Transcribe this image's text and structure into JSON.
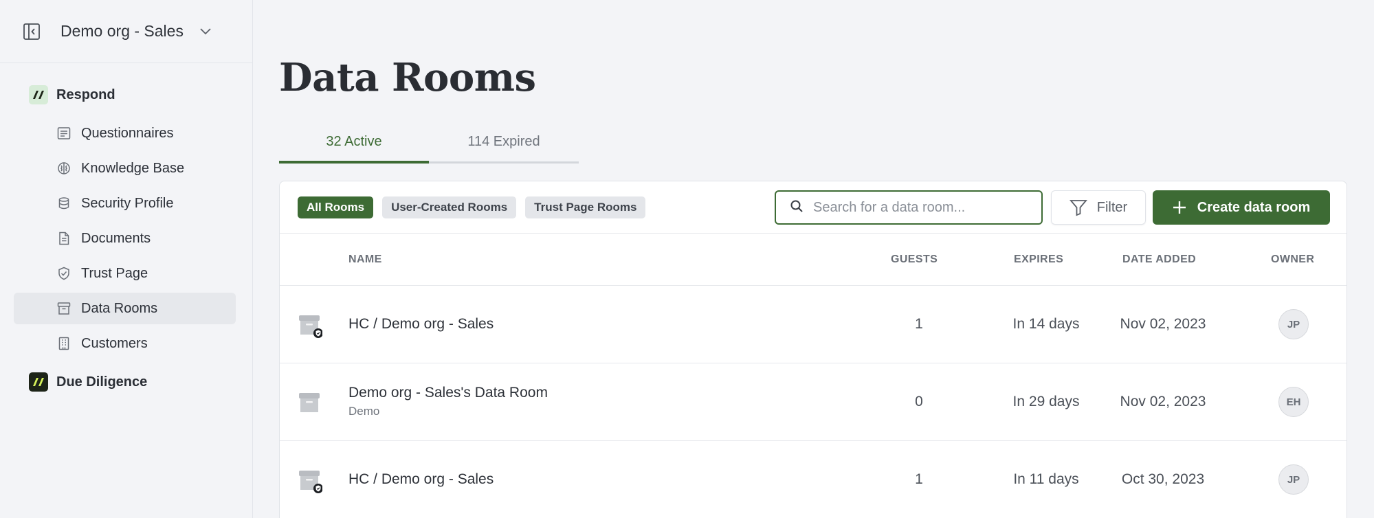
{
  "org": {
    "name": "Demo org - Sales"
  },
  "sidebar": {
    "groups": [
      {
        "label": "Respond",
        "items": [
          {
            "label": "Questionnaires",
            "icon": "questionnaire-icon"
          },
          {
            "label": "Knowledge Base",
            "icon": "brain-icon"
          },
          {
            "label": "Security Profile",
            "icon": "database-icon"
          },
          {
            "label": "Documents",
            "icon": "document-icon"
          },
          {
            "label": "Trust Page",
            "icon": "shield-icon"
          },
          {
            "label": "Data Rooms",
            "icon": "archive-icon",
            "active": true
          },
          {
            "label": "Customers",
            "icon": "building-icon"
          }
        ]
      },
      {
        "label": "Due Diligence",
        "items": []
      }
    ]
  },
  "page": {
    "title": "Data Rooms"
  },
  "tabs": [
    {
      "label": "32 Active",
      "active": true
    },
    {
      "label": "114 Expired",
      "active": false
    }
  ],
  "toolbar": {
    "chips": [
      {
        "label": "All Rooms",
        "active": true
      },
      {
        "label": "User-Created Rooms",
        "active": false
      },
      {
        "label": "Trust Page Rooms",
        "active": false
      }
    ],
    "search_placeholder": "Search for a data room...",
    "filter_label": "Filter",
    "create_label": "Create data room"
  },
  "table": {
    "columns": {
      "name": "NAME",
      "guests": "GUESTS",
      "expires": "EXPIRES",
      "date_added": "DATE ADDED",
      "owner": "OWNER"
    },
    "rows": [
      {
        "name": "HC / Demo org - Sales",
        "sub": "",
        "guests": "1",
        "expires": "In 14 days",
        "date_added": "Nov 02, 2023",
        "owner": "JP",
        "trust_badge": true
      },
      {
        "name": "Demo org - Sales's Data Room",
        "sub": "Demo",
        "guests": "0",
        "expires": "In 29 days",
        "date_added": "Nov 02, 2023",
        "owner": "EH",
        "trust_badge": false
      },
      {
        "name": "HC / Demo org - Sales",
        "sub": "",
        "guests": "1",
        "expires": "In 11 days",
        "date_added": "Oct 30, 2023",
        "owner": "JP",
        "trust_badge": true
      }
    ]
  },
  "colors": {
    "accent": "#3d6b34",
    "sidebar_bg": "#f3f4f7",
    "active_nav": "#e6e8ec"
  }
}
